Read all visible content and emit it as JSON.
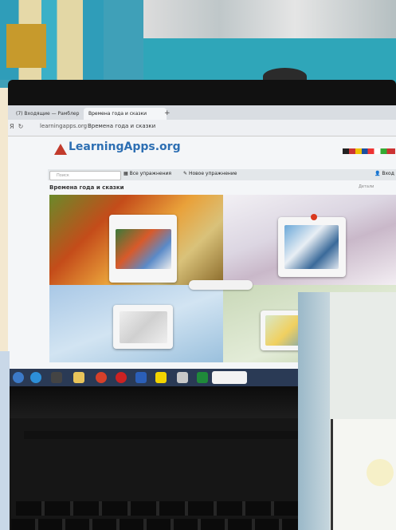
{
  "browser": {
    "tabs": [
      {
        "label": "(7) Входящие — Рамблер"
      },
      {
        "label": "Времена года и сказки"
      }
    ],
    "new_tab": "+",
    "url": "learningapps.org",
    "address_title": "Времена года и сказки"
  },
  "site": {
    "logo_text": "LearningApps.org",
    "search_placeholder": "Поиск",
    "menu_all": "Все упражнения",
    "menu_new": "Новое упражнение",
    "menu_login": "Вход"
  },
  "app": {
    "title": "Времена года и сказки",
    "share_label": "Детали"
  },
  "icons": [
    "back-icon",
    "reload-icon",
    "search-icon",
    "windows-start-icon",
    "ie-icon",
    "chrome-icon",
    "opera-icon",
    "word-icon",
    "yandex-icon",
    "excel-icon",
    "folder-icon"
  ]
}
